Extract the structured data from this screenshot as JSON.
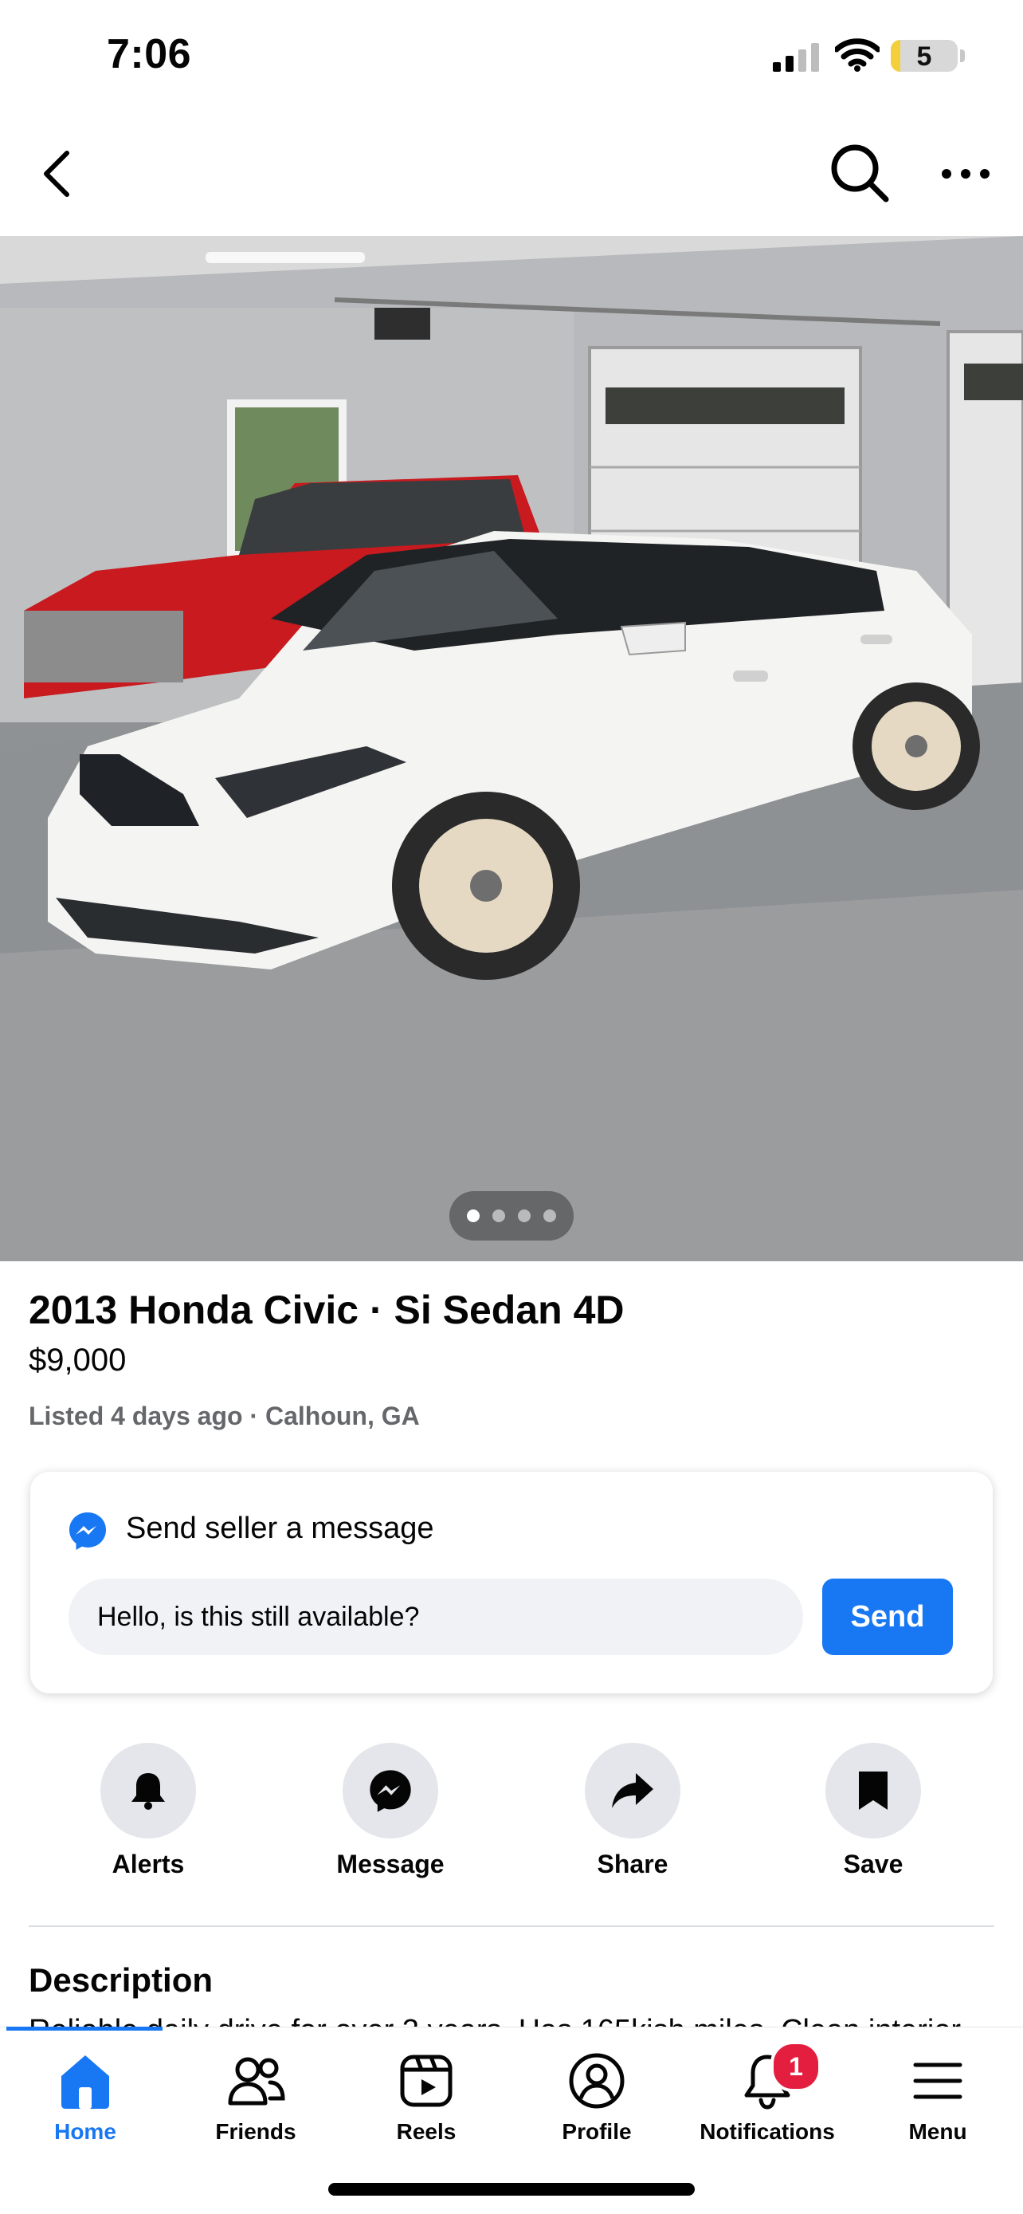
{
  "status_bar": {
    "time": "7:06",
    "battery_level": "5"
  },
  "listing": {
    "photo_count": 4,
    "active_photo": 1,
    "title": "2013 Honda Civic · Si Sedan 4D",
    "price": "$9,000",
    "meta": "Listed 4 days ago · Calhoun, GA"
  },
  "message_card": {
    "icon": "messenger-icon",
    "title": "Send seller a message",
    "input_value": "Hello, is this still available?",
    "send_label": "Send"
  },
  "actions": [
    {
      "label": "Alerts",
      "icon": "bell-icon"
    },
    {
      "label": "Message",
      "icon": "messenger-icon"
    },
    {
      "label": "Share",
      "icon": "share-arrow-icon"
    },
    {
      "label": "Save",
      "icon": "bookmark-icon"
    }
  ],
  "description": {
    "title": "Description",
    "text": "Reliable daily drive for over 3 years. Has 165kish miles. Clean interior"
  },
  "tabbar": {
    "tabs": [
      {
        "label": "Home",
        "icon": "home-icon",
        "active": true
      },
      {
        "label": "Friends",
        "icon": "friends-icon"
      },
      {
        "label": "Reels",
        "icon": "reels-icon"
      },
      {
        "label": "Profile",
        "icon": "profile-icon"
      },
      {
        "label": "Notifications",
        "icon": "bell-icon"
      },
      {
        "label": "Menu",
        "icon": "hamburger-icon"
      }
    ],
    "notification_badge": "1"
  },
  "colors": {
    "accent": "#1877f2",
    "badge": "#e41e3f",
    "muted_text": "#65676b",
    "button_bg": "#e4e6eb"
  }
}
